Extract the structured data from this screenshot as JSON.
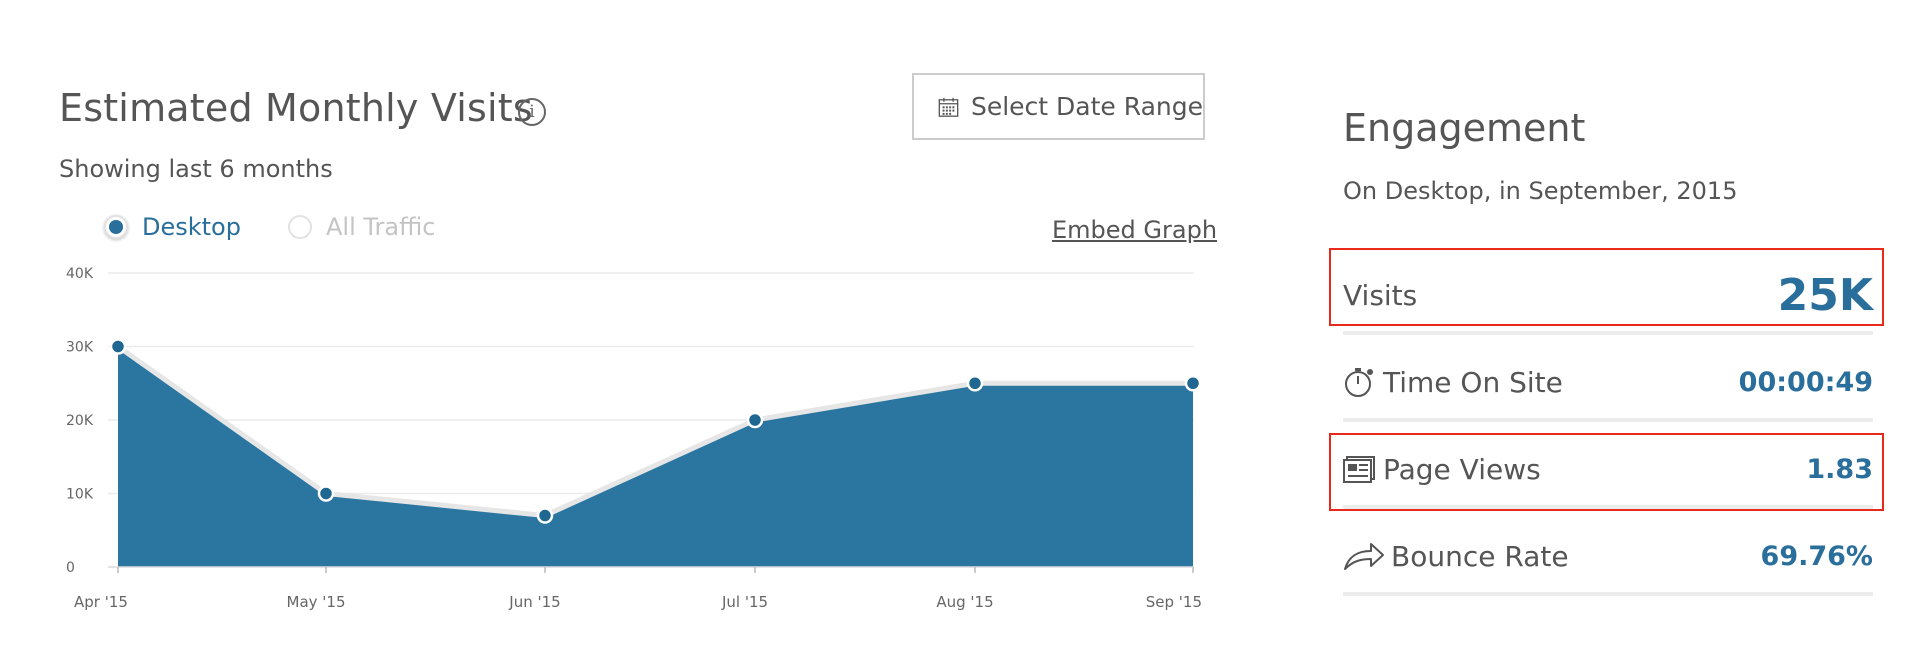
{
  "visits": {
    "title": "Estimated Monthly Visits",
    "info_symbol": "i",
    "subtitle": "Showing last 6 months",
    "date_button_label": "Select Date Range",
    "radios": [
      {
        "label": "Desktop",
        "checked": true
      },
      {
        "label": "All Traffic",
        "checked": false
      }
    ],
    "embed_label": "Embed Graph"
  },
  "chart_data": {
    "type": "area",
    "categories": [
      "Apr '15",
      "May '15",
      "Jun '15",
      "Jul '15",
      "Aug '15",
      "Sep '15"
    ],
    "series": [
      {
        "values": [
          30000,
          10000,
          7000,
          20000,
          25000,
          25000
        ],
        "color": "#2a76a1"
      }
    ],
    "y_ticks": [
      "0",
      "10K",
      "20K",
      "30K",
      "40K"
    ],
    "ylim": [
      0,
      40000
    ],
    "grid": true,
    "line_color": "#e6e6e6",
    "marker_color": "#1f6791"
  },
  "engagement": {
    "title": "Engagement",
    "subtitle": "On Desktop, in September, 2015",
    "metrics": [
      {
        "name": "Visits",
        "value": "25K",
        "icon": "none",
        "highlighted": true
      },
      {
        "name": "Time On Site",
        "value": "00:00:49",
        "icon": "stopwatch-icon",
        "highlighted": false
      },
      {
        "name": "Page Views",
        "value": "1.83",
        "icon": "page-views-icon",
        "highlighted": true
      },
      {
        "name": "Bounce Rate",
        "value": "69.76%",
        "icon": "share-arrow-icon",
        "highlighted": false
      }
    ]
  },
  "colors": {
    "accent": "#2a6e9c",
    "highlight_border": "#e8291c"
  }
}
